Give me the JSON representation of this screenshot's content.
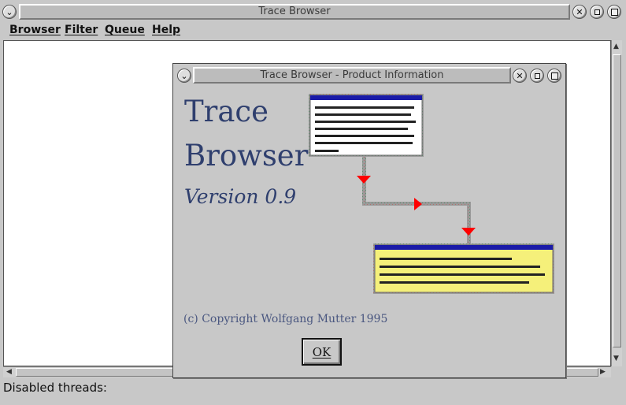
{
  "main_window": {
    "title": "Trace Browser",
    "menu": [
      "Browser",
      "Filter",
      "Queue",
      "Help"
    ],
    "status_text": "Disabled threads:"
  },
  "dialog": {
    "title": "Trace Browser - Product Information",
    "app_name_line1": "Trace",
    "app_name_line2": "Browser",
    "version": "Version 0.9",
    "copyright": "(c) Copyright Wolfgang Mutter 1995",
    "ok_label": "OK"
  },
  "colors": {
    "title_text": "#2f3f6e",
    "window_bg": "#c8c8c8",
    "illustration_arrow": "#ff0000",
    "trace_window_bg": "#f5f07a",
    "window_titlebar": "#1a1aa8"
  }
}
